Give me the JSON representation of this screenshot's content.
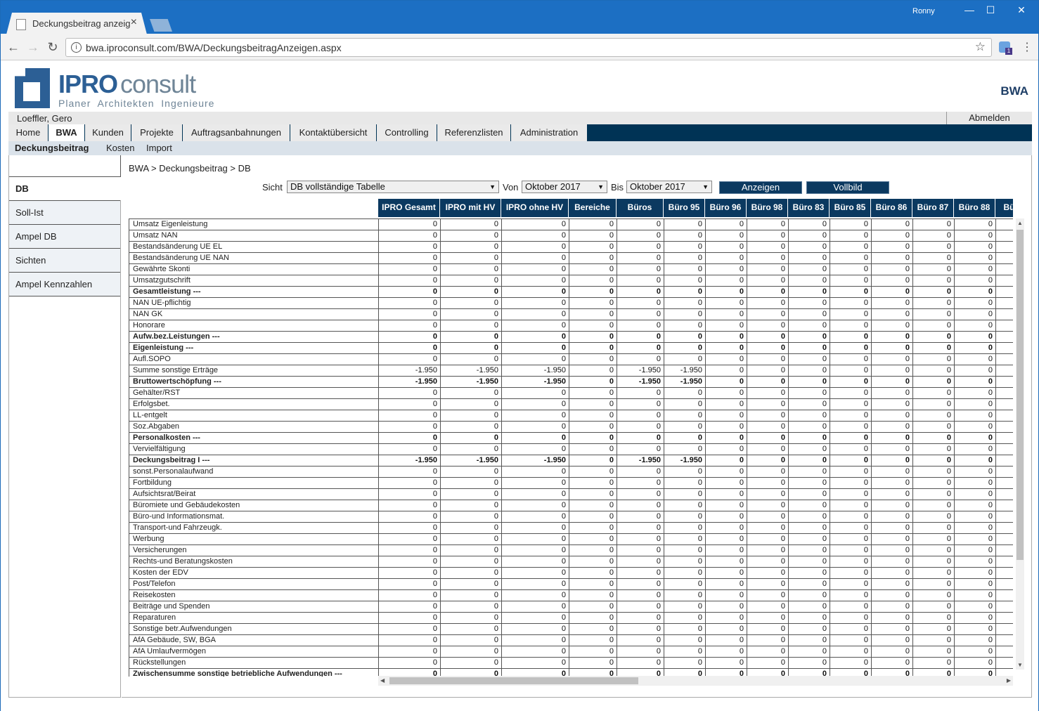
{
  "browser": {
    "tab_title": "Deckungsbeitrag anzeige",
    "user": "Ronny",
    "url": "bwa.iproconsult.com/BWA/DeckungsbeitragAnzeigen.aspx",
    "info_icon": "i"
  },
  "logo": {
    "ipro": "IPRO",
    "consult": "consult",
    "sub": "Planer  Architekten  Ingenieure"
  },
  "app_title": "BWA",
  "user_name": "Loeffler, Gero",
  "logout": "Abmelden",
  "main_nav": [
    "Home",
    "BWA",
    "Kunden",
    "Projekte",
    "Auftragsanbahnungen",
    "Kontaktübersicht",
    "Controlling",
    "Referenzlisten",
    "Administration"
  ],
  "sub_nav": [
    "Deckungsbeitrag",
    "Kosten",
    "Import"
  ],
  "sidebar": [
    "DB",
    "Soll-Ist",
    "Ampel DB",
    "Sichten",
    "Ampel Kennzahlen"
  ],
  "breadcrumb": "BWA > Deckungsbeitrag > DB",
  "controls": {
    "sicht_label": "Sicht",
    "sicht_value": "DB vollständige Tabelle",
    "von_label": "Von",
    "von_value": "Oktober 2017",
    "bis_label": "Bis",
    "bis_value": "Oktober 2017",
    "show_button": "Anzeigen",
    "fullscreen_button": "Vollbild"
  },
  "table": {
    "columns": [
      "IPRO Gesamt",
      "IPRO mit HV",
      "IPRO ohne HV",
      "Bereiche",
      "Büros",
      "Büro 95",
      "Büro 96",
      "Büro 98",
      "Büro 83",
      "Büro 85",
      "Büro 86",
      "Büro 87",
      "Büro 88",
      "Bü"
    ],
    "rows": [
      {
        "label": "Umsatz Eigenleistung",
        "bold": false,
        "values": [
          "0",
          "0",
          "0",
          "0",
          "0",
          "0",
          "0",
          "0",
          "0",
          "0",
          "0",
          "0",
          "0",
          ""
        ]
      },
      {
        "label": "Umsatz NAN",
        "bold": false,
        "values": [
          "0",
          "0",
          "0",
          "0",
          "0",
          "0",
          "0",
          "0",
          "0",
          "0",
          "0",
          "0",
          "0",
          ""
        ]
      },
      {
        "label": "Bestandsänderung UE EL",
        "bold": false,
        "values": [
          "0",
          "0",
          "0",
          "0",
          "0",
          "0",
          "0",
          "0",
          "0",
          "0",
          "0",
          "0",
          "0",
          ""
        ]
      },
      {
        "label": "Bestandsänderung UE NAN",
        "bold": false,
        "values": [
          "0",
          "0",
          "0",
          "0",
          "0",
          "0",
          "0",
          "0",
          "0",
          "0",
          "0",
          "0",
          "0",
          ""
        ]
      },
      {
        "label": "Gewährte Skonti",
        "bold": false,
        "values": [
          "0",
          "0",
          "0",
          "0",
          "0",
          "0",
          "0",
          "0",
          "0",
          "0",
          "0",
          "0",
          "0",
          ""
        ]
      },
      {
        "label": "Umsatzgutschrift",
        "bold": false,
        "values": [
          "0",
          "0",
          "0",
          "0",
          "0",
          "0",
          "0",
          "0",
          "0",
          "0",
          "0",
          "0",
          "0",
          ""
        ]
      },
      {
        "label": "Gesamtleistung ---",
        "bold": true,
        "values": [
          "0",
          "0",
          "0",
          "0",
          "0",
          "0",
          "0",
          "0",
          "0",
          "0",
          "0",
          "0",
          "0",
          ""
        ]
      },
      {
        "label": "NAN UE-pflichtig",
        "bold": false,
        "values": [
          "0",
          "0",
          "0",
          "0",
          "0",
          "0",
          "0",
          "0",
          "0",
          "0",
          "0",
          "0",
          "0",
          ""
        ]
      },
      {
        "label": "NAN GK",
        "bold": false,
        "values": [
          "0",
          "0",
          "0",
          "0",
          "0",
          "0",
          "0",
          "0",
          "0",
          "0",
          "0",
          "0",
          "0",
          ""
        ]
      },
      {
        "label": "Honorare",
        "bold": false,
        "values": [
          "0",
          "0",
          "0",
          "0",
          "0",
          "0",
          "0",
          "0",
          "0",
          "0",
          "0",
          "0",
          "0",
          ""
        ]
      },
      {
        "label": "Aufw.bez.Leistungen ---",
        "bold": true,
        "values": [
          "0",
          "0",
          "0",
          "0",
          "0",
          "0",
          "0",
          "0",
          "0",
          "0",
          "0",
          "0",
          "0",
          ""
        ]
      },
      {
        "label": "Eigenleistung ---",
        "bold": true,
        "values": [
          "0",
          "0",
          "0",
          "0",
          "0",
          "0",
          "0",
          "0",
          "0",
          "0",
          "0",
          "0",
          "0",
          ""
        ]
      },
      {
        "label": "Aufl.SOPO",
        "bold": false,
        "values": [
          "0",
          "0",
          "0",
          "0",
          "0",
          "0",
          "0",
          "0",
          "0",
          "0",
          "0",
          "0",
          "0",
          ""
        ]
      },
      {
        "label": "Summe sonstige Erträge",
        "bold": false,
        "values": [
          "-1.950",
          "-1.950",
          "-1.950",
          "0",
          "-1.950",
          "-1.950",
          "0",
          "0",
          "0",
          "0",
          "0",
          "0",
          "0",
          ""
        ]
      },
      {
        "label": "Bruttowertschöpfung ---",
        "bold": true,
        "values": [
          "-1.950",
          "-1.950",
          "-1.950",
          "0",
          "-1.950",
          "-1.950",
          "0",
          "0",
          "0",
          "0",
          "0",
          "0",
          "0",
          ""
        ]
      },
      {
        "label": "Gehälter/RST",
        "bold": false,
        "values": [
          "0",
          "0",
          "0",
          "0",
          "0",
          "0",
          "0",
          "0",
          "0",
          "0",
          "0",
          "0",
          "0",
          ""
        ]
      },
      {
        "label": "Erfolgsbet.",
        "bold": false,
        "values": [
          "0",
          "0",
          "0",
          "0",
          "0",
          "0",
          "0",
          "0",
          "0",
          "0",
          "0",
          "0",
          "0",
          ""
        ]
      },
      {
        "label": "LL-entgelt",
        "bold": false,
        "values": [
          "0",
          "0",
          "0",
          "0",
          "0",
          "0",
          "0",
          "0",
          "0",
          "0",
          "0",
          "0",
          "0",
          ""
        ]
      },
      {
        "label": "Soz.Abgaben",
        "bold": false,
        "values": [
          "0",
          "0",
          "0",
          "0",
          "0",
          "0",
          "0",
          "0",
          "0",
          "0",
          "0",
          "0",
          "0",
          ""
        ]
      },
      {
        "label": "Personalkosten ---",
        "bold": true,
        "values": [
          "0",
          "0",
          "0",
          "0",
          "0",
          "0",
          "0",
          "0",
          "0",
          "0",
          "0",
          "0",
          "0",
          ""
        ]
      },
      {
        "label": "Vervielfältigung",
        "bold": false,
        "values": [
          "0",
          "0",
          "0",
          "0",
          "0",
          "0",
          "0",
          "0",
          "0",
          "0",
          "0",
          "0",
          "0",
          ""
        ]
      },
      {
        "label": "Deckungsbeitrag I ---",
        "bold": true,
        "values": [
          "-1.950",
          "-1.950",
          "-1.950",
          "0",
          "-1.950",
          "-1.950",
          "0",
          "0",
          "0",
          "0",
          "0",
          "0",
          "0",
          ""
        ]
      },
      {
        "label": "sonst.Personalaufwand",
        "bold": false,
        "values": [
          "0",
          "0",
          "0",
          "0",
          "0",
          "0",
          "0",
          "0",
          "0",
          "0",
          "0",
          "0",
          "0",
          ""
        ]
      },
      {
        "label": "Fortbildung",
        "bold": false,
        "values": [
          "0",
          "0",
          "0",
          "0",
          "0",
          "0",
          "0",
          "0",
          "0",
          "0",
          "0",
          "0",
          "0",
          ""
        ]
      },
      {
        "label": "Aufsichtsrat/Beirat",
        "bold": false,
        "values": [
          "0",
          "0",
          "0",
          "0",
          "0",
          "0",
          "0",
          "0",
          "0",
          "0",
          "0",
          "0",
          "0",
          ""
        ]
      },
      {
        "label": "Büromiete und Gebäudekosten",
        "bold": false,
        "values": [
          "0",
          "0",
          "0",
          "0",
          "0",
          "0",
          "0",
          "0",
          "0",
          "0",
          "0",
          "0",
          "0",
          ""
        ]
      },
      {
        "label": "Büro-und Informationsmat.",
        "bold": false,
        "values": [
          "0",
          "0",
          "0",
          "0",
          "0",
          "0",
          "0",
          "0",
          "0",
          "0",
          "0",
          "0",
          "0",
          ""
        ]
      },
      {
        "label": "Transport-und Fahrzeugk.",
        "bold": false,
        "values": [
          "0",
          "0",
          "0",
          "0",
          "0",
          "0",
          "0",
          "0",
          "0",
          "0",
          "0",
          "0",
          "0",
          ""
        ]
      },
      {
        "label": "Werbung",
        "bold": false,
        "values": [
          "0",
          "0",
          "0",
          "0",
          "0",
          "0",
          "0",
          "0",
          "0",
          "0",
          "0",
          "0",
          "0",
          ""
        ]
      },
      {
        "label": "Versicherungen",
        "bold": false,
        "values": [
          "0",
          "0",
          "0",
          "0",
          "0",
          "0",
          "0",
          "0",
          "0",
          "0",
          "0",
          "0",
          "0",
          ""
        ]
      },
      {
        "label": "Rechts-und Beratungskosten",
        "bold": false,
        "values": [
          "0",
          "0",
          "0",
          "0",
          "0",
          "0",
          "0",
          "0",
          "0",
          "0",
          "0",
          "0",
          "0",
          ""
        ]
      },
      {
        "label": "Kosten der EDV",
        "bold": false,
        "values": [
          "0",
          "0",
          "0",
          "0",
          "0",
          "0",
          "0",
          "0",
          "0",
          "0",
          "0",
          "0",
          "0",
          ""
        ]
      },
      {
        "label": "Post/Telefon",
        "bold": false,
        "values": [
          "0",
          "0",
          "0",
          "0",
          "0",
          "0",
          "0",
          "0",
          "0",
          "0",
          "0",
          "0",
          "0",
          ""
        ]
      },
      {
        "label": "Reisekosten",
        "bold": false,
        "values": [
          "0",
          "0",
          "0",
          "0",
          "0",
          "0",
          "0",
          "0",
          "0",
          "0",
          "0",
          "0",
          "0",
          ""
        ]
      },
      {
        "label": "Beiträge und Spenden",
        "bold": false,
        "values": [
          "0",
          "0",
          "0",
          "0",
          "0",
          "0",
          "0",
          "0",
          "0",
          "0",
          "0",
          "0",
          "0",
          ""
        ]
      },
      {
        "label": "Reparaturen",
        "bold": false,
        "values": [
          "0",
          "0",
          "0",
          "0",
          "0",
          "0",
          "0",
          "0",
          "0",
          "0",
          "0",
          "0",
          "0",
          ""
        ]
      },
      {
        "label": "Sonstige betr.Aufwendungen",
        "bold": false,
        "values": [
          "0",
          "0",
          "0",
          "0",
          "0",
          "0",
          "0",
          "0",
          "0",
          "0",
          "0",
          "0",
          "0",
          ""
        ]
      },
      {
        "label": "AfA Gebäude, SW, BGA",
        "bold": false,
        "values": [
          "0",
          "0",
          "0",
          "0",
          "0",
          "0",
          "0",
          "0",
          "0",
          "0",
          "0",
          "0",
          "0",
          ""
        ]
      },
      {
        "label": "AfA Umlaufvermögen",
        "bold": false,
        "values": [
          "0",
          "0",
          "0",
          "0",
          "0",
          "0",
          "0",
          "0",
          "0",
          "0",
          "0",
          "0",
          "0",
          ""
        ]
      },
      {
        "label": "Rückstellungen",
        "bold": false,
        "values": [
          "0",
          "0",
          "0",
          "0",
          "0",
          "0",
          "0",
          "0",
          "0",
          "0",
          "0",
          "0",
          "0",
          ""
        ]
      },
      {
        "label": "Zwischensumme sonstige betriebliche Aufwendungen ---",
        "bold": true,
        "values": [
          "0",
          "0",
          "0",
          "0",
          "0",
          "0",
          "0",
          "0",
          "0",
          "0",
          "0",
          "0",
          "0",
          ""
        ]
      }
    ]
  },
  "colors": {
    "nav_dark": "#003355",
    "header_dark": "#0b3960",
    "brand": "#2c5f95",
    "titlebar": "#1c6fc3"
  }
}
